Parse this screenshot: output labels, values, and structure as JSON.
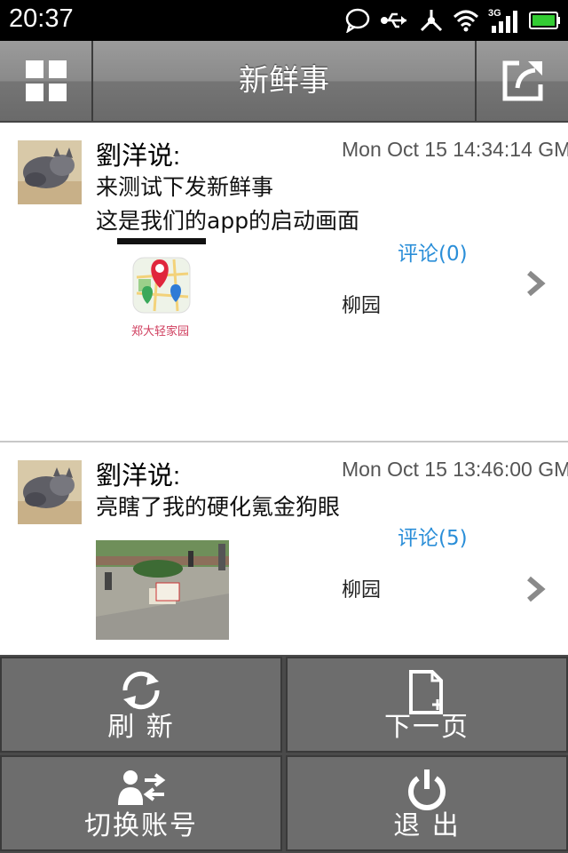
{
  "status_bar": {
    "time": "20:37",
    "network": "3G"
  },
  "header": {
    "title": "新鲜事"
  },
  "posts": [
    {
      "author": "劉洋说:",
      "time": "Mon Oct 15 14:34:14 GM",
      "text_lines": [
        "来测试下发新鲜事",
        "这是我们的app的启动画面"
      ],
      "comments": "评论(0)",
      "location": "柳园",
      "thumb_caption": "郑大轻家园"
    },
    {
      "author": "劉洋说:",
      "time": "Mon Oct 15 13:46:00 GM",
      "text_lines": [
        "亮瞎了我的硬化氪金狗眼"
      ],
      "comments": "评论(5)",
      "location": "柳园"
    }
  ],
  "menu": {
    "refresh_label": "刷 新",
    "next_page_label": "下一页",
    "switch_account_label": "切换账号",
    "exit_label": "退 出"
  },
  "colors": {
    "accent_link": "#2a8ed8",
    "status_bar": "#000000",
    "battery": "#33cc33"
  },
  "icons": [
    "grid-icon",
    "share-icon",
    "refresh-icon",
    "new-page-icon",
    "switch-account-icon",
    "power-icon",
    "chevron-right-icon"
  ]
}
